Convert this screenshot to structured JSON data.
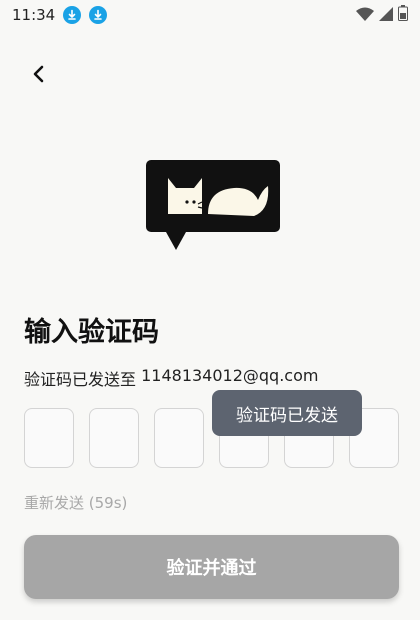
{
  "status_bar": {
    "time": "11:34",
    "icons": [
      "download-icon",
      "download-icon",
      "wifi-icon",
      "signal-icon",
      "battery-icon"
    ]
  },
  "nav": {
    "back_icon": "chevron-left-icon"
  },
  "title": "输入验证码",
  "sent": {
    "prefix": "验证码已发送至 ",
    "email": "1148134012@qq.com"
  },
  "code_inputs": [
    "",
    "",
    "",
    "",
    "",
    ""
  ],
  "toast": "验证码已发送",
  "resend_label": "重新发送 (59s)",
  "submit_label": "验证并通过",
  "colors": {
    "background": "#f8f8f6",
    "download_badge": "#1aa2e6",
    "toast_bg": "#5d6470",
    "button_disabled": "#a6a6a6",
    "muted_text": "#a8a8a8"
  }
}
